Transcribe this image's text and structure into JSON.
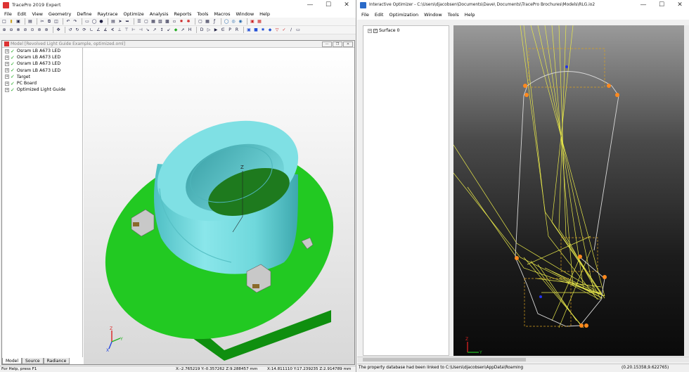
{
  "left_window": {
    "title": "TracePro 2019 Expert",
    "menu": [
      "File",
      "Edit",
      "View",
      "Geometry",
      "Define",
      "Raytrace",
      "Optimize",
      "Analysis",
      "Reports",
      "Tools",
      "Macros",
      "Window",
      "Help"
    ],
    "model_window_title": "Model [Revolved Light Guide Example, optimized.oml]",
    "tree_items": [
      {
        "label": "Osram LB A673 LED"
      },
      {
        "label": "Osram LB A673 LED"
      },
      {
        "label": "Osram LB A673 LED"
      },
      {
        "label": "Osram LB A673 LED"
      },
      {
        "label": "Target"
      },
      {
        "label": "PC Board"
      },
      {
        "label": "Optimized Light Guide"
      }
    ],
    "tabs": [
      "Model",
      "Source",
      "Radiance"
    ],
    "axis_labels": {
      "z": "Z",
      "y": "Y",
      "x": "X"
    },
    "status": {
      "help": "For Help, press F1",
      "coord1": "X:-2.765219 Y:-0.357262 Z:9.288457 mm",
      "coord2": "X:14.811110 Y:17.239235 Z:2.914789 mm"
    }
  },
  "right_window": {
    "title": "Interactive Optimizer - C:\\Users\\djacobsen\\Documents\\Dave\\ Documents\\TracePro Brochures\\Models\\RLG.io2",
    "menu": [
      "File",
      "Edit",
      "Optimization",
      "Window",
      "Tools",
      "Help"
    ],
    "tree_items": [
      {
        "label": "Surface 0"
      }
    ],
    "status": {
      "message": "The property database had been linked to C:\\Users\\djacobsen\\AppData\\Roaming",
      "coords": "(0.20.15358,9.622765)"
    }
  },
  "colors": {
    "light_guide": "#6fd8dc",
    "pc_board": "#22c922",
    "rays": "#e8e84a",
    "control_point": "#ff8a1e"
  }
}
